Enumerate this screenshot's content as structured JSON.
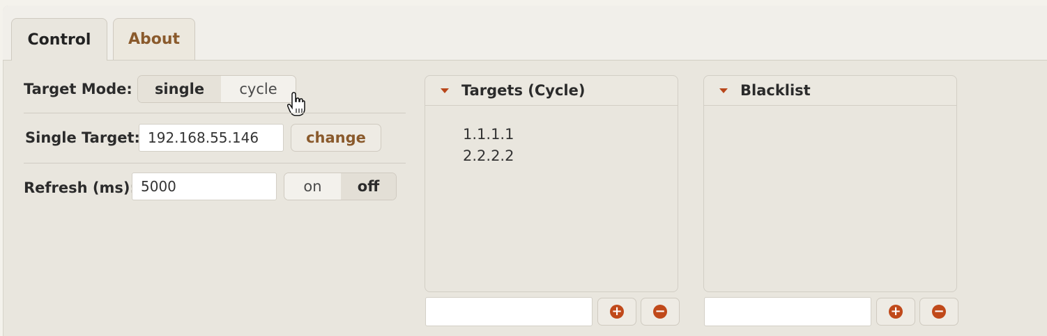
{
  "tabs": [
    {
      "label": "Control",
      "active": true
    },
    {
      "label": "About",
      "active": false
    }
  ],
  "control": {
    "target_mode": {
      "label": "Target Mode:",
      "options": [
        "single",
        "cycle"
      ],
      "selected": "cycle"
    },
    "single_target": {
      "label": "Single Target:",
      "value": "192.168.55.146",
      "button": "change"
    },
    "refresh": {
      "label": "Refresh (ms):",
      "value": "5000",
      "on_label": "on",
      "off_label": "off",
      "selected": "off"
    }
  },
  "targets_panel": {
    "title": "Targets (Cycle)",
    "items": [
      "1.1.1.1",
      "2.2.2.2"
    ],
    "input_value": "",
    "add_icon": "plus-circle-icon",
    "remove_icon": "minus-circle-icon"
  },
  "blacklist_panel": {
    "title": "Blacklist",
    "items": [],
    "input_value": "",
    "add_icon": "plus-circle-icon",
    "remove_icon": "minus-circle-icon"
  },
  "colors": {
    "accent": "#c0491a",
    "tab_inactive_text": "#8a5a2c",
    "background": "#e9e6de"
  }
}
